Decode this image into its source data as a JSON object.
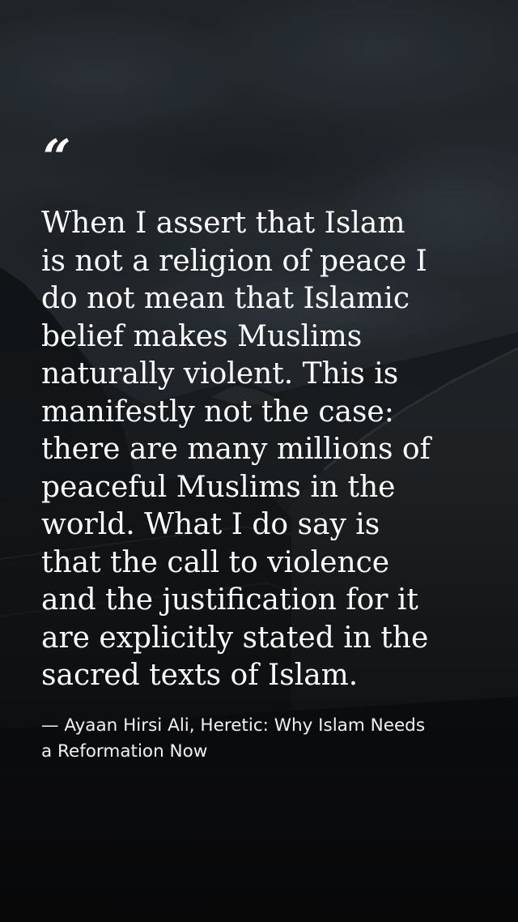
{
  "quote": {
    "mark": "“",
    "text": "When I assert that Islam\nis not a religion of peace I\ndo not mean that Islamic\nbelief makes Muslims\nnaturally violent. This is\nmanifestly not the case:\nthere are many millions of\npeaceful Muslims in the\nworld. What I do say is\nthat the call to violence\nand the justification for it\nare explicitly stated in the\nsacred texts of Islam.",
    "attribution": "— Ayaan Hirsi Ali, Heretic: Why Islam Needs\na Reformation Now"
  },
  "colors": {
    "text": "#ffffff",
    "sky_top": "#2b3238",
    "ground": "#0f1113"
  }
}
